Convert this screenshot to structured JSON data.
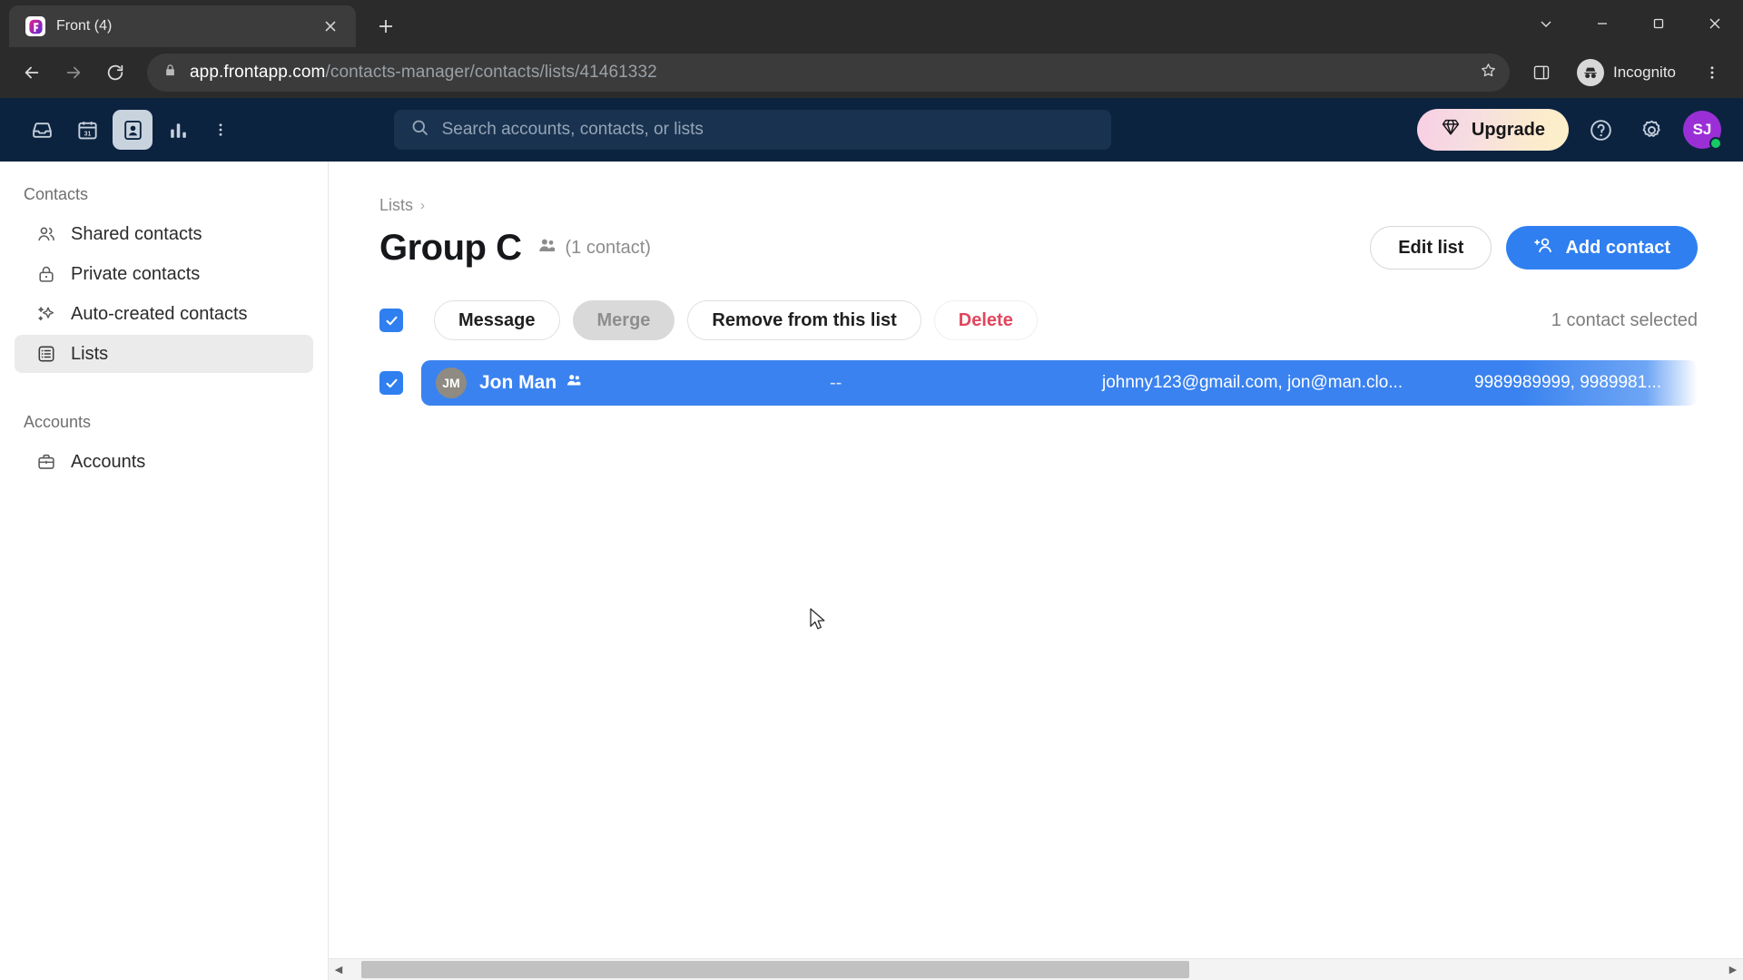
{
  "browser": {
    "tab": {
      "title": "Front (4)",
      "favicon_icon": "front-logo-icon",
      "close_icon": "close-icon"
    },
    "new_tab_icon": "plus-icon",
    "window_controls": {
      "minimize_label": "chevron-down-icon",
      "minimize2_label": "minimize-icon",
      "maximize_label": "maximize-icon",
      "close_label": "close-icon"
    },
    "nav": {
      "back_icon": "back-arrow-icon",
      "forward_icon": "forward-arrow-icon",
      "reload_icon": "reload-icon"
    },
    "omnibox": {
      "lock_icon": "lock-icon",
      "url_domain": "app.frontapp.com",
      "url_path": "/contacts-manager/contacts/lists/41461332",
      "url_full": "app.frontapp.com/contacts-manager/contacts/lists/41461332",
      "star_icon": "bookmark-star-icon"
    },
    "side_panel_icon": "side-panel-icon",
    "incognito_label": "Incognito",
    "incognito_icon": "incognito-icon",
    "menu_icon": "kebab-menu-icon"
  },
  "app_topbar": {
    "nav_icons": [
      {
        "name": "inbox-icon",
        "label": "Inbox",
        "active": false
      },
      {
        "name": "calendar-icon",
        "label": "Calendar",
        "active": false
      },
      {
        "name": "contacts-icon",
        "label": "Contacts",
        "active": true
      },
      {
        "name": "analytics-icon",
        "label": "Analytics",
        "active": false
      },
      {
        "name": "more-kebab-icon",
        "label": "More",
        "active": false
      }
    ],
    "search": {
      "placeholder": "Search accounts, contacts, or lists",
      "icon": "search-icon"
    },
    "upgrade": {
      "label": "Upgrade",
      "icon": "diamond-icon"
    },
    "help_icon": "help-circle-icon",
    "settings_icon": "gear-icon",
    "avatar": {
      "initials": "SJ",
      "presence": "online"
    }
  },
  "sidebar": {
    "sections": [
      {
        "title": "Contacts",
        "items": [
          {
            "label": "Shared contacts",
            "icon": "people-icon",
            "active": false
          },
          {
            "label": "Private contacts",
            "icon": "lock-icon",
            "active": false
          },
          {
            "label": "Auto-created contacts",
            "icon": "sparkle-icon",
            "active": false
          },
          {
            "label": "Lists",
            "icon": "list-icon",
            "active": true
          }
        ]
      },
      {
        "title": "Accounts",
        "items": [
          {
            "label": "Accounts",
            "icon": "briefcase-icon",
            "active": false
          }
        ]
      }
    ]
  },
  "main": {
    "breadcrumb": {
      "parent": "Lists",
      "separator": "›"
    },
    "title": "Group C",
    "contact_count_label": "(1 contact)",
    "contact_count_icon": "people-icon",
    "edit_list_label": "Edit list",
    "add_contact_label": "Add contact",
    "add_contact_icon": "person-plus-icon",
    "toolbar": {
      "select_all_checked": true,
      "message_label": "Message",
      "merge_label": "Merge",
      "merge_disabled": true,
      "remove_label": "Remove from this list",
      "delete_label": "Delete",
      "selected_count_label": "1 contact selected"
    },
    "table": {
      "rows": [
        {
          "checked": true,
          "avatar_initials": "JM",
          "name": "Jon Man",
          "name_badge_icon": "people-icon",
          "company": "--",
          "emails": "johnny123@gmail.com, jon@man.clo...",
          "phones": "9989989999, 9989981..."
        }
      ]
    },
    "scrollbar": {
      "left_arrow": "◀",
      "right_arrow": "▶"
    }
  },
  "colors": {
    "accent_blue": "#2f7ff0",
    "row_selected_blue": "#3a82ef",
    "topbar_navy": "#0c2340",
    "danger_red": "#e0475e",
    "avatar_purple": "#9b2fd6",
    "presence_green": "#17c964"
  }
}
